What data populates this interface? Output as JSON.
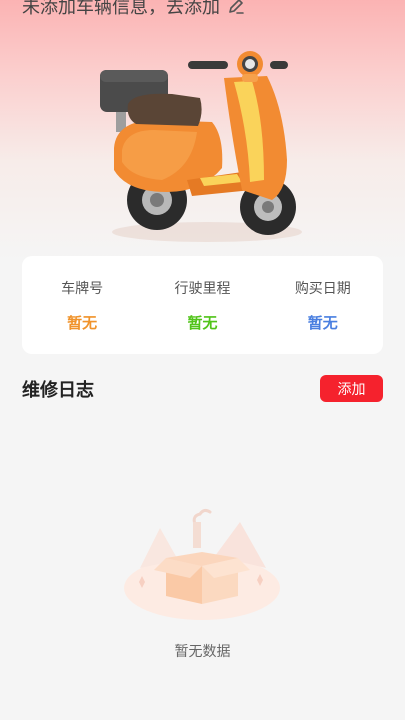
{
  "header": {
    "prompt_text": "未添加车辆信息，去添加",
    "edit_icon": "edit-pencil-icon"
  },
  "vehicle_image": {
    "icon": "orange-scooter-illustration"
  },
  "stats": [
    {
      "label": "车牌号",
      "value": "暂无",
      "color": "#f0932b"
    },
    {
      "label": "行驶里程",
      "value": "暂无",
      "color": "#52c41a"
    },
    {
      "label": "购买日期",
      "value": "暂无",
      "color": "#4a7fe0"
    }
  ],
  "maintenance": {
    "title": "维修日志",
    "add_label": "添加",
    "add_color": "#f5222d"
  },
  "empty_state": {
    "icon": "empty-box-illustration",
    "text": "暂无数据"
  }
}
